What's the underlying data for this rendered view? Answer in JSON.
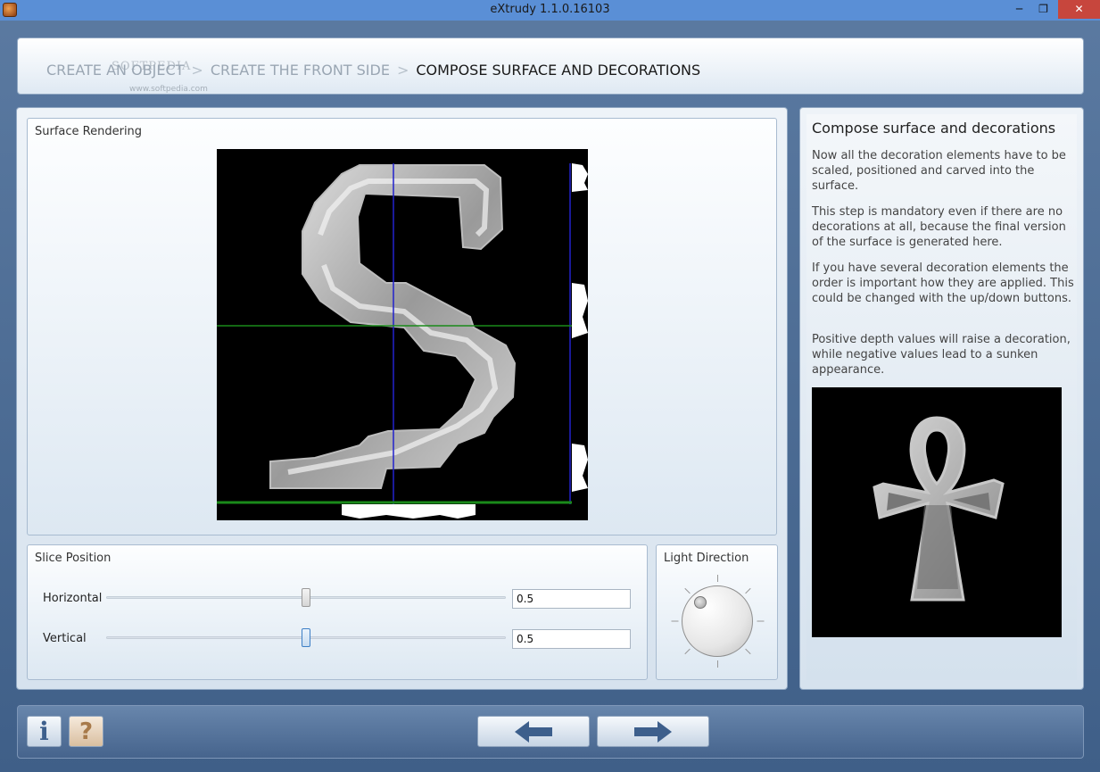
{
  "window": {
    "title": "eXtrudy 1.1.0.16103",
    "minimize": "─",
    "maximize": "❐",
    "close": "✕"
  },
  "breadcrumb": {
    "steps": [
      "CREATE AN OBJECT",
      "CREATE THE FRONT SIDE",
      "COMPOSE SURFACE AND DECORATIONS"
    ],
    "separator": ">",
    "active_index": 2,
    "watermark": "SOFTPEDIA",
    "watermark_url": "www.softpedia.com"
  },
  "surface": {
    "label": "Surface Rendering",
    "glyph": "S"
  },
  "slice": {
    "label": "Slice Position",
    "horizontal": {
      "label": "Horizontal",
      "value": "0.5",
      "fraction": 0.5
    },
    "vertical": {
      "label": "Vertical",
      "value": "0.5",
      "fraction": 0.5
    }
  },
  "light": {
    "label": "Light Direction"
  },
  "info": {
    "title": "Compose surface and decorations",
    "paragraphs": [
      "Now all the decoration elements have to be scaled, positioned and carved into the surface.",
      "This step is mandatory even if there are no decorations at all, because the final version of the surface is generated here.",
      "If you have several decoration elements the order is important how they are applied. This could be changed with the up/down buttons.",
      "Positive depth values will raise a decoration, while negative values lead to a sunken appearance."
    ],
    "image_icon": "ankh-icon"
  },
  "buttons": {
    "info": "i",
    "help": "?",
    "back_icon": "arrow-left-icon",
    "next_icon": "arrow-right-icon"
  },
  "colors": {
    "titlebar": "#5a8fd6",
    "close": "#c7463d",
    "guide_vertical": "#2222cc",
    "guide_horizontal": "#1a8a1a",
    "arrow": "#3d5f8c"
  }
}
